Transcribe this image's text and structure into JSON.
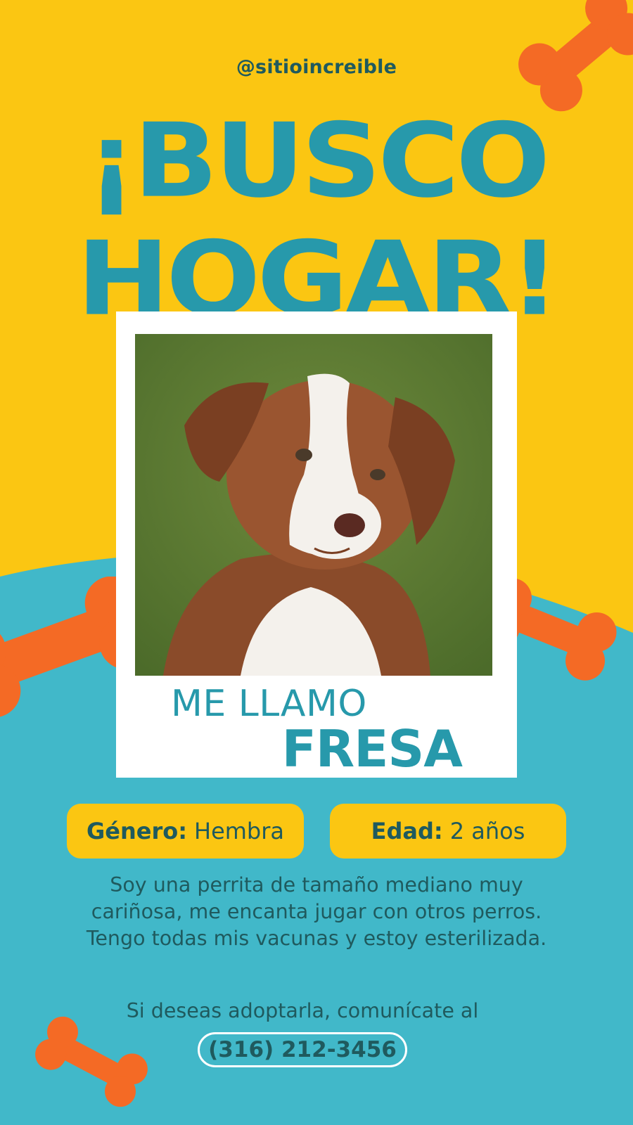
{
  "poster": {
    "handle": "@sitioincreible",
    "headline_line1": "¡BUSCO",
    "headline_line2": "HOGAR!",
    "photo_subject": "dog-puppy-photo",
    "intro": "ME LLAMO",
    "pet_name": "FRESA",
    "gender_label": "Género:",
    "gender_value": "Hembra",
    "age_label": "Edad:",
    "age_value": "2 años",
    "description_lines": [
      "Soy una perrita de tamaño mediano muy",
      "cariñosa, me encanta jugar con otros perros.",
      "Tengo todas mis vacunas y estoy esterilizada."
    ],
    "contact_text": "Si deseas adoptarla, comunícate al",
    "phone": "(316) 212-3456"
  },
  "colors": {
    "yellow": "#fbc612",
    "teal_background": "#41b8c9",
    "headline_teal": "#2799ab",
    "dark_text": "#1f5a5e",
    "bone_orange": "#f46a25",
    "white": "#ffffff"
  },
  "decorations": [
    "bone-icon",
    "bone-icon",
    "bone-icon",
    "bone-icon"
  ]
}
